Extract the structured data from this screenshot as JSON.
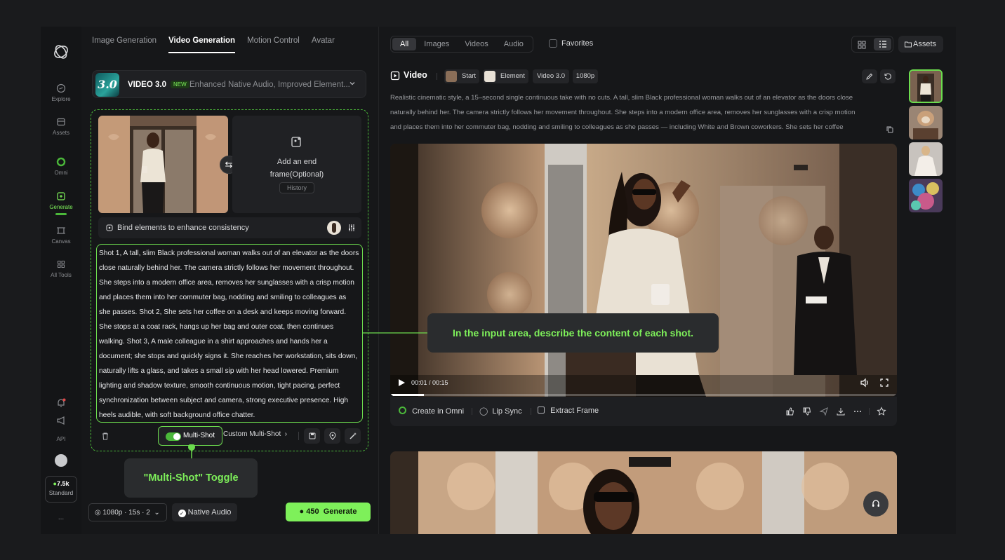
{
  "sidebar": {
    "items": [
      {
        "label": "Explore",
        "icon": "compass-icon"
      },
      {
        "label": "Assets",
        "icon": "folder-icon"
      },
      {
        "label": "Omni",
        "icon": "omni-icon"
      },
      {
        "label": "Generate",
        "icon": "generate-icon"
      },
      {
        "label": "Canvas",
        "icon": "canvas-icon"
      },
      {
        "label": "All Tools",
        "icon": "grid-icon"
      }
    ],
    "api_label": "API",
    "credits": "7.5k",
    "plan": "Standard",
    "more": "..."
  },
  "panel": {
    "tabs": [
      "Image Generation",
      "Video Generation",
      "Motion Control",
      "Avatar"
    ],
    "active_tab": "Video Generation",
    "model": {
      "thumb_text": "3.0",
      "name": "VIDEO 3.0",
      "badge": "NEW",
      "description": "Enhanced Native Audio, Improved Element..."
    },
    "end_frame": {
      "line1": "Add an end",
      "line2": "frame(Optional)",
      "history": "History"
    },
    "bind_label": "Bind elements to enhance consistency",
    "prompt": "Shot 1, A tall, slim Black professional woman walks out of an elevator as the doors close naturally behind her. The camera strictly follows her movement throughout. She steps into a modern office area, removes her sunglasses with a crisp motion and places them into her commuter bag, nodding and smiling to colleagues as she passes. Shot 2, She sets her coffee on a desk and keeps moving forward. She stops at a coat rack, hangs up her bag and outer coat, then continues walking. Shot 3, A male colleague in a shirt approaches and hands her a document; she stops and quickly signs it. She reaches her workstation, sits down, naturally lifts a glass, and takes a small sip with her head lowered. Premium lighting and shadow texture, smooth continuous motion, tight pacing, perfect synchronization between subject and camera, strong executive presence. High heels audible, with soft background office chatter.",
    "multi_shot_label": "Multi-Shot",
    "multi_shot_on": true,
    "custom_multi_shot": "Custom Multi-Shot",
    "settings": "1080p · 15s · 2",
    "native_audio": "Native Audio",
    "generate_cost": "450",
    "generate_label": "Generate"
  },
  "callouts": {
    "prompt_hint": "In the input area, describe the content of each shot.",
    "toggle_hint": "\"Multi-Shot\" Toggle"
  },
  "main": {
    "filters": [
      "All",
      "Images",
      "Videos",
      "Audio"
    ],
    "active_filter": "All",
    "favorites": "Favorites",
    "assets": "Assets",
    "video_title": "Video",
    "tags": {
      "start": "Start",
      "element": "Element",
      "model": "Video 3.0",
      "res": "1080p"
    },
    "description": [
      "Realistic cinematic style, a 15–second single continuous take with no cuts. A tall, slim Black professional woman walks out of an elevator as the doors close",
      "naturally behind her. The camera strictly follows her movement throughout. She steps into a modern office area, removes her sunglasses with a crisp motion",
      "and places them into her commuter bag, nodding and smiling to colleagues as she passes — including White and Brown coworkers. She sets her coffee"
    ],
    "time": "00:01 / 00:15",
    "progress": 0.067,
    "actions": {
      "omni": "Create in Omni",
      "lipsync": "Lip Sync",
      "extract": "Extract Frame"
    }
  },
  "colors": {
    "accent": "#7ef05a",
    "accent_dark": "#4bb83a",
    "bg": "#161719"
  }
}
